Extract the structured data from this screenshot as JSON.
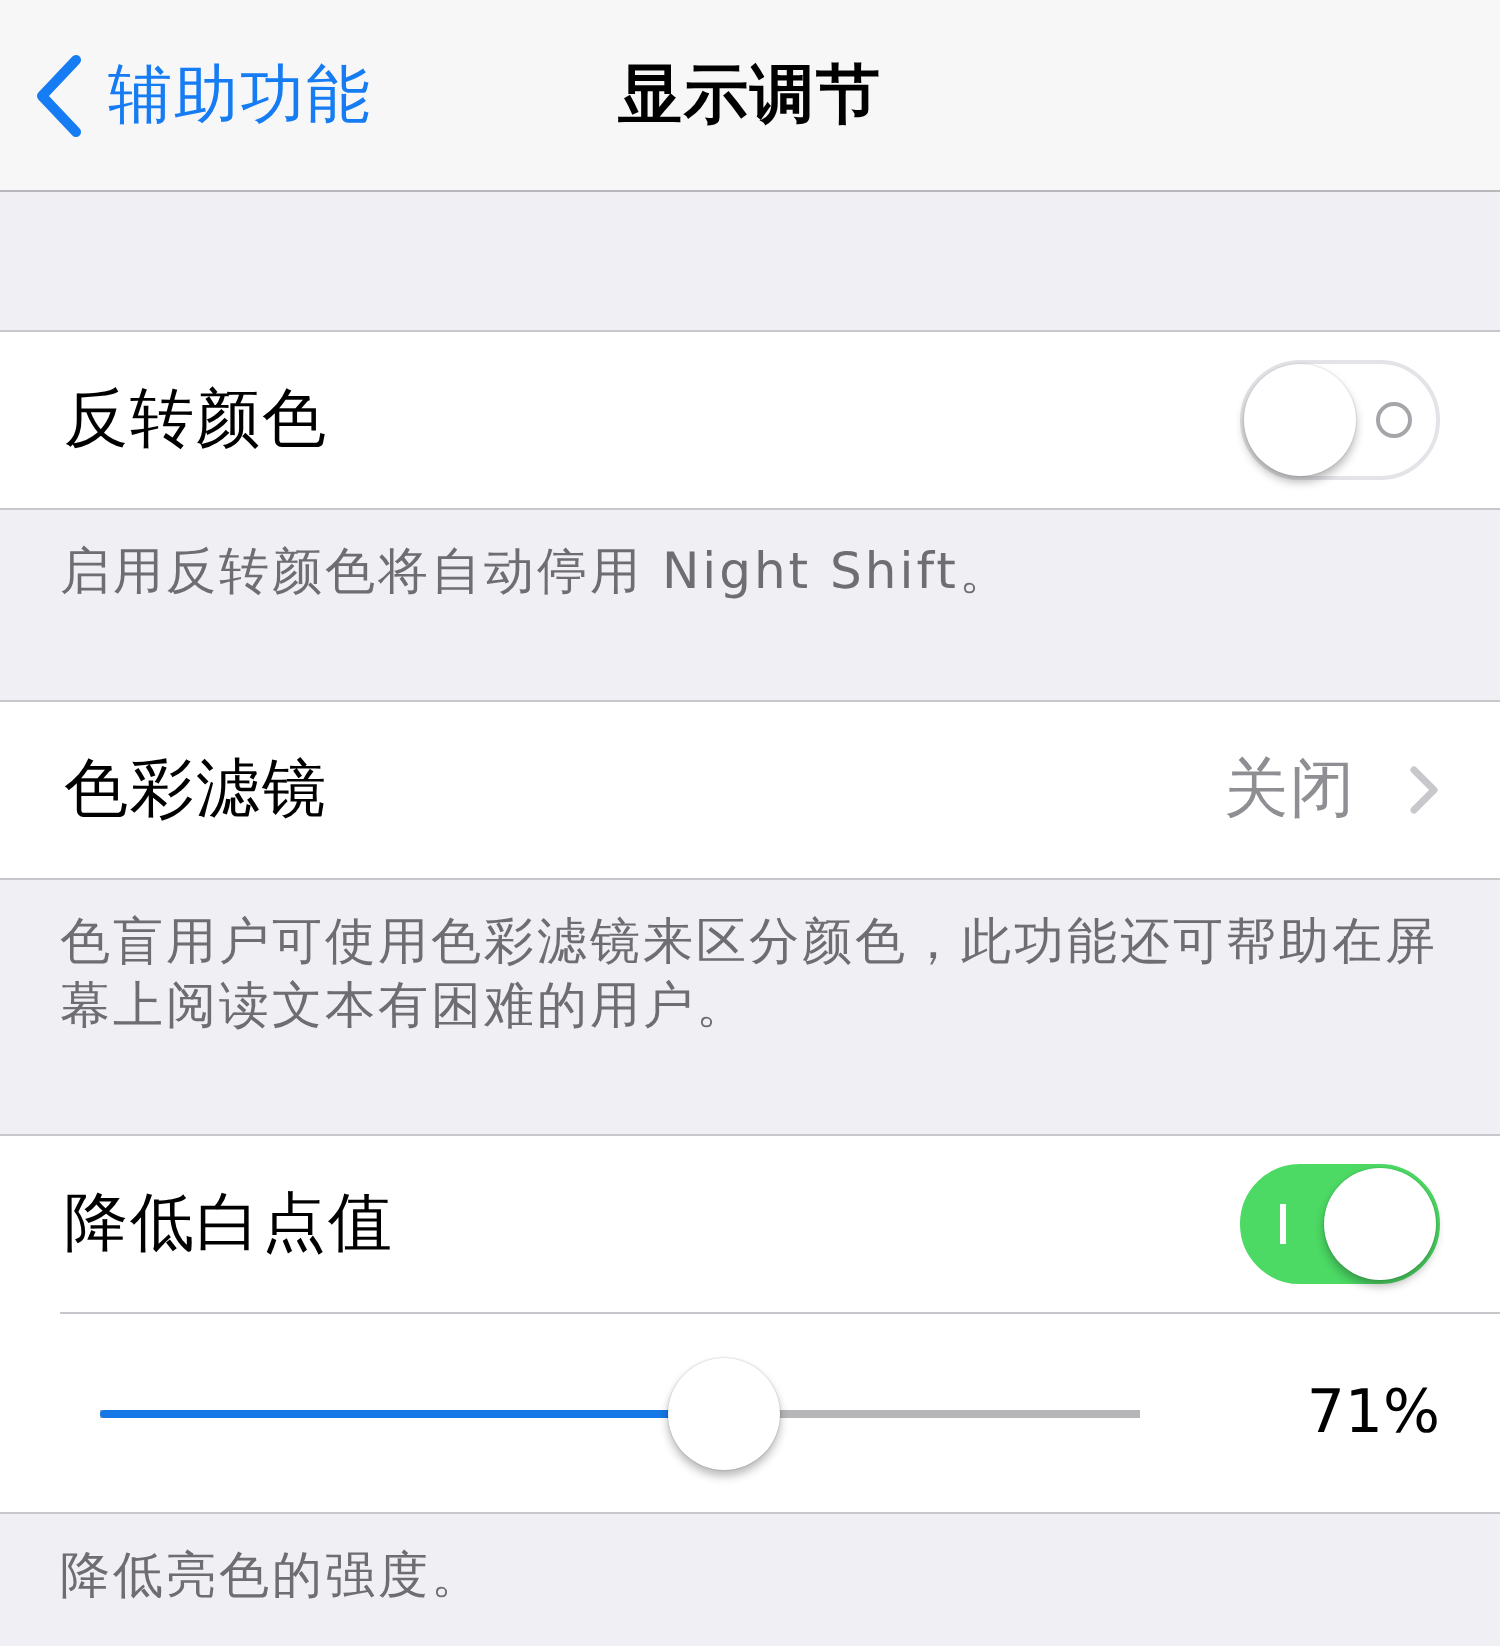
{
  "nav_bar": {
    "back_label": "辅助功能",
    "title": "显示调节"
  },
  "sections": [
    {
      "rows": [
        {
          "kind": "toggle",
          "label": "反转颜色",
          "on": false
        }
      ],
      "footer": "启用反转颜色将自动停用 Night Shift。"
    },
    {
      "rows": [
        {
          "kind": "disclosure",
          "label": "色彩滤镜",
          "value": "关闭"
        }
      ],
      "footer": "色盲用户可使用色彩滤镜来区分颜色，此功能还可帮助在屏幕上阅读文本有困难的用户。"
    },
    {
      "rows": [
        {
          "kind": "toggle",
          "label": "降低白点值",
          "on": true
        },
        {
          "kind": "slider",
          "level": 0.6,
          "reading": "71%"
        }
      ],
      "footer": "降低亮色的强度。"
    }
  ]
}
